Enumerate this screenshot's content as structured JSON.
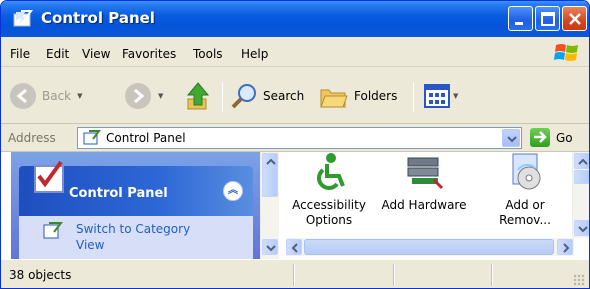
{
  "window": {
    "title": "Control Panel"
  },
  "menu": {
    "items": [
      {
        "label": "File"
      },
      {
        "label": "Edit"
      },
      {
        "label": "View"
      },
      {
        "label": "Favorites"
      },
      {
        "label": "Tools"
      },
      {
        "label": "Help"
      }
    ]
  },
  "toolbar": {
    "back_label": "Back",
    "search_label": "Search",
    "folders_label": "Folders"
  },
  "address": {
    "label": "Address",
    "value": "Control Panel",
    "go_label": "Go"
  },
  "taskpane": {
    "title": "Control Panel",
    "link_line1": "Switch to Category",
    "link_line2": "View"
  },
  "items": [
    {
      "line1": "Accessibility",
      "line2": "Options",
      "icon": "accessibility-icon"
    },
    {
      "line1": "Add Hardware",
      "line2": "",
      "icon": "add-hardware-icon"
    },
    {
      "line1": "Add or",
      "line2": "Remov...",
      "icon": "add-remove-programs-icon"
    }
  ],
  "status": {
    "text": "38 objects"
  },
  "colors": {
    "titlebar": "#0553d8",
    "taskpane": "#6375d6",
    "link": "#215dc6",
    "chrome": "#ece9d8"
  }
}
